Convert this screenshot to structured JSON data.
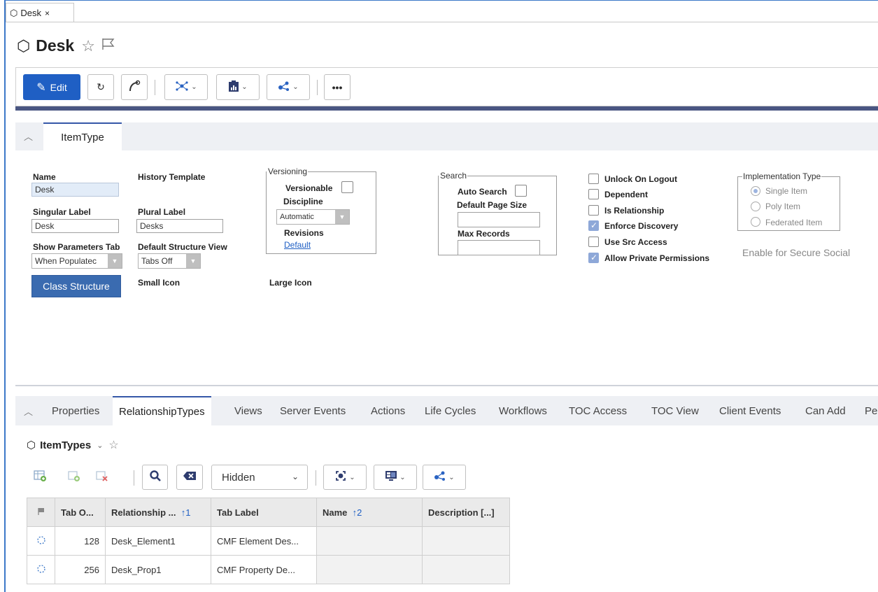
{
  "doc_tab": {
    "label": "Desk",
    "close": "×"
  },
  "title": {
    "text": "Desk"
  },
  "toolbar": {
    "edit_label": "Edit",
    "more": "•••"
  },
  "item_panel": {
    "tab_label": "ItemType"
  },
  "form": {
    "name_label": "Name",
    "name_value": "Desk",
    "history_template_label": "History Template",
    "singular_label": "Singular Label",
    "singular_value": "Desk",
    "plural_label": "Plural Label",
    "plural_value": "Desks",
    "show_params_label": "Show Parameters Tab",
    "show_params_value": "When Populatec",
    "default_structure_label": "Default Structure View",
    "default_structure_value": "Tabs Off",
    "class_structure_button": "Class Structure",
    "small_icon_label": "Small Icon",
    "large_icon_label": "Large Icon"
  },
  "versioning": {
    "legend": "Versioning",
    "versionable_label": "Versionable",
    "discipline_label": "Discipline",
    "discipline_value": "Automatic",
    "revisions_label": "Revisions",
    "revisions_link": "Default"
  },
  "search": {
    "legend": "Search",
    "auto_search_label": "Auto Search",
    "page_size_label": "Default Page Size",
    "max_records_label": "Max Records"
  },
  "checks": [
    {
      "label": "Unlock On Logout",
      "checked": false
    },
    {
      "label": "Dependent",
      "checked": false
    },
    {
      "label": "Is Relationship",
      "checked": false
    },
    {
      "label": "Enforce Discovery",
      "checked": true
    },
    {
      "label": "Use Src Access",
      "checked": false
    },
    {
      "label": "Allow Private Permissions",
      "checked": true
    }
  ],
  "implementation": {
    "legend": "Implementation Type",
    "options": [
      "Single Item",
      "Poly Item",
      "Federated Item"
    ],
    "selected": "Single Item",
    "secure_social": "Enable for Secure Social"
  },
  "rel_tabs": [
    "Properties",
    "RelationshipTypes",
    "Views",
    "Server Events",
    "Actions",
    "Life Cycles",
    "Workflows",
    "TOC Access",
    "TOC View",
    "Client Events",
    "Can Add",
    "Pe"
  ],
  "grid": {
    "title": "ItemTypes",
    "filter_value": "Hidden",
    "columns": [
      "Tab O...",
      "Relationship ...",
      "Tab Label",
      "Name",
      "Description [...]"
    ],
    "sort1": "1",
    "sort2": "2",
    "rows": [
      {
        "tab_order": "128",
        "relationship": "Desk_Element1",
        "tab_label": "CMF Element Des...",
        "name": "",
        "description": ""
      },
      {
        "tab_order": "256",
        "relationship": "Desk_Prop1",
        "tab_label": "CMF Property De...",
        "name": "",
        "description": ""
      }
    ]
  }
}
